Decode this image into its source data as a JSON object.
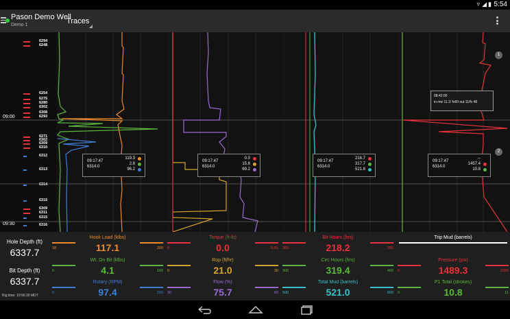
{
  "status": {
    "time": "5:54"
  },
  "appbar": {
    "well_name": "Pason Demo Well",
    "well_sub": "Demo 1",
    "view_selector": "Traces"
  },
  "depth_labels": [
    "6294",
    "6248",
    "6254",
    "6275",
    "6280",
    "6302",
    "6308",
    "6293",
    "6271",
    "6302",
    "6309",
    "6310",
    "6312",
    "6313",
    "6314",
    "6315",
    "6309",
    "6311",
    "6315",
    "6316"
  ],
  "time_labels": [
    "09:00",
    "09:30"
  ],
  "popups": [
    {
      "time": "09:17:47",
      "depth": "6314.0",
      "values": [
        "119.3",
        "2.8",
        "96.2"
      ],
      "colors": [
        "#f08a2a",
        "#5cb83c",
        "#3f7fd6"
      ]
    },
    {
      "time": "09:17:47",
      "depth": "6314.0",
      "values": [
        "0.0",
        "15.6",
        "69.2"
      ],
      "colors": [
        "#e8323c",
        "#d6a530",
        "#9b6bd6"
      ]
    },
    {
      "time": "09:17:47",
      "depth": "6314.0",
      "values": [
        "216.7",
        "317.7",
        "521.6"
      ],
      "colors": [
        "#e8323c",
        "#5cb83c",
        "#38c0c8"
      ]
    },
    {
      "time": "09:17:47",
      "depth": "6314.0",
      "values": [
        "--",
        "1457.4",
        "10.8"
      ],
      "colors": [
        "#ffffff",
        "#e8323c",
        "#5cb83c"
      ]
    }
  ],
  "annotation": {
    "time": "08:42:00",
    "text": "in mw 11.1/ fv60 out 11/fv 48"
  },
  "badges": [
    "1",
    "2"
  ],
  "left_readouts": [
    {
      "label": "Hole Depth (ft)",
      "value": "6337.7"
    },
    {
      "label": "Bit Depth (ft)",
      "value": "6337.7"
    }
  ],
  "rig_time": "Rig time: 10:56:30 MDT",
  "readouts": [
    {
      "name": "Hook Load (klbs)",
      "value": "117.1",
      "min": "18",
      "max": "200",
      "color": "#f08a2a"
    },
    {
      "name": "Torque (ft-lb)",
      "value": "0.0",
      "min": "0",
      "max": "0.01",
      "color": "#e8323c"
    },
    {
      "name": "Bit Hours (hrs)",
      "value": "218.2",
      "min": "200",
      "max": "300",
      "color": "#e8323c"
    },
    {
      "name": "Trip Mud (barrels)",
      "value": "",
      "min": "",
      "max": "",
      "color": "#ffffff"
    },
    {
      "name": "Wt. On Bit (klbs)",
      "value": "4.1",
      "min": "0",
      "max": "100",
      "color": "#5cb83c"
    },
    {
      "name": "Rop (ft/hr)",
      "value": "21.0",
      "min": "0",
      "max": "30",
      "color": "#d6a530"
    },
    {
      "name": "Circ Hours (hrs)",
      "value": "319.4",
      "min": "300",
      "max": "400",
      "color": "#5cb83c"
    },
    {
      "name": "Pressure (psi)",
      "value": "1489.3",
      "min": "0",
      "max": "2000",
      "color": "#e8323c"
    },
    {
      "name": "Rotary (RPM)",
      "value": "97.4",
      "min": "0",
      "max": "200",
      "color": "#3f7fd6"
    },
    {
      "name": "Flow (%)",
      "value": "75.7",
      "min": "30",
      "max": "89",
      "color": "#9b6bd6"
    },
    {
      "name": "Total Mud (barrels)",
      "value": "521.0",
      "min": "500",
      "max": "600",
      "color": "#38c0c8"
    },
    {
      "name": "P1 Total (strokes)",
      "value": "10.8",
      "min": "0",
      "max": "11",
      "color": "#5cb83c"
    }
  ]
}
